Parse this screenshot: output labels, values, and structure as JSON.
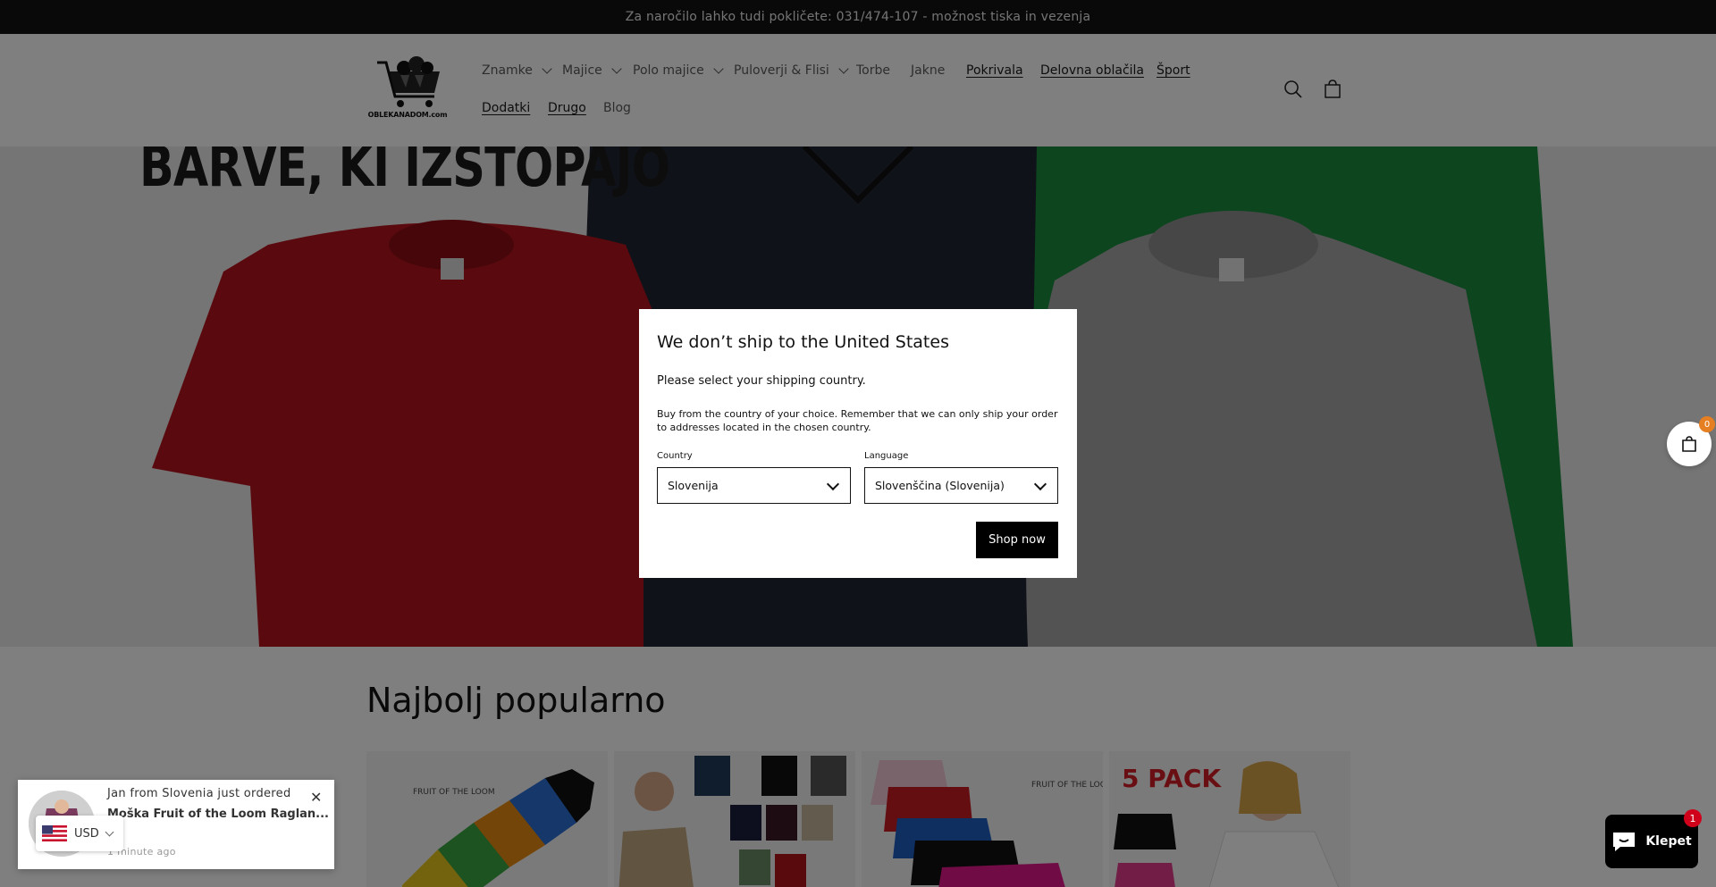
{
  "announcement": "Za naročilo lahko tudi pokličete: 031/474-107 - možnost tiska in vezenja",
  "logo": {
    "text": "OBLEKANADOM.com"
  },
  "nav": {
    "row1": [
      {
        "label": "Znamke",
        "dropdown": true
      },
      {
        "label": "Majice",
        "dropdown": true
      },
      {
        "label": "Polo majice",
        "dropdown": true
      },
      {
        "label": "Puloverji & Flisi",
        "dropdown": true
      },
      {
        "label": "Torbe",
        "dropdown": false
      },
      {
        "label": "Jakne",
        "dropdown": false
      },
      {
        "label": "Pokrivala",
        "underlined": true
      },
      {
        "label": "Delovna oblačila",
        "underlined": true
      },
      {
        "label": "Šport",
        "underlined": true
      }
    ],
    "row2": [
      {
        "label": "Dodatki",
        "underlined": true
      },
      {
        "label": "Drugo",
        "underlined": true
      },
      {
        "label": "Blog"
      }
    ]
  },
  "header_icons": {
    "search": "search-icon",
    "cart": "cart-icon"
  },
  "hero": {
    "title": "BARVE, KI IZSTOPAJO"
  },
  "modal": {
    "title": "We don’t ship to the United States",
    "subtitle": "Please select your shipping country.",
    "body": "Buy from the country of your choice. Remember that we can only ship your order to addresses located in the chosen country.",
    "country_label": "Country",
    "country_value": "Slovenija",
    "language_label": "Language",
    "language_value": "Slovenščina (Slovenija)",
    "button": "Shop now"
  },
  "section": {
    "title": "Najbolj popularno"
  },
  "products": [
    {
      "badge": "FRUIT OF THE LOOM"
    },
    {
      "badge": ""
    },
    {
      "badge": "FRUIT OF THE LOOM"
    },
    {
      "badge": "5 PACK"
    }
  ],
  "floating_cart": {
    "count": "0"
  },
  "toast": {
    "line1": "Jan from Slovenia just ordered",
    "line2": "Moška Fruit of the Loom Raglan...",
    "line3": "1 minute ago"
  },
  "currency": {
    "code": "USD"
  },
  "chat": {
    "label": "Klepet",
    "badge": "1"
  },
  "colors": {
    "accent": "#121212",
    "chat": "#000000",
    "badge": "#d0021b"
  }
}
